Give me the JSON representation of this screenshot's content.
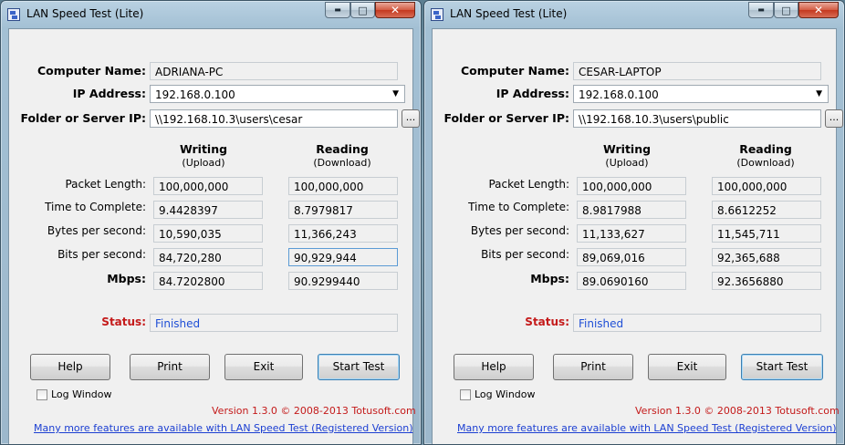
{
  "windows": [
    {
      "title": "LAN Speed Test (Lite)",
      "controls": {
        "minimize": "▬",
        "maximize": "□",
        "close": "✕"
      },
      "labels": {
        "computer_name": "Computer Name:",
        "ip_address": "IP Address:",
        "folder": "Folder or Server IP:",
        "packet_length": "Packet Length:",
        "time_to_complete": "Time to Complete:",
        "bytes_per_second": "Bytes per second:",
        "bits_per_second": "Bits per second:",
        "mbps": "Mbps:",
        "status": "Status:"
      },
      "computer_name": "ADRIANA-PC",
      "ip_address": "192.168.0.100",
      "folder": "\\\\192.168.10.3\\users\\cesar",
      "browse_label": "...",
      "columns": {
        "writing": "Writing",
        "upload": "(Upload)",
        "reading": "Reading",
        "download": "(Download)"
      },
      "rows": {
        "packet_length": {
          "write": "100,000,000",
          "read": "100,000,000"
        },
        "time_to_complete": {
          "write": "9.4428397",
          "read": "8.7979817"
        },
        "bytes_per_second": {
          "write": "10,590,035",
          "read": "11,366,243"
        },
        "bits_per_second": {
          "write": "84,720,280",
          "read": "90,929,944"
        },
        "mbps": {
          "write": "84.7202800",
          "read": "90.9299440"
        }
      },
      "status": "Finished",
      "buttons": {
        "help": "Help",
        "print": "Print",
        "exit": "Exit",
        "start": "Start Test"
      },
      "log_window": "Log Window",
      "version": "Version 1.3.0 © 2008-2013 Totusoft.com",
      "link": "Many more features are available with LAN Speed Test (Registered Version)"
    },
    {
      "title": "LAN Speed Test (Lite)",
      "controls": {
        "minimize": "▬",
        "maximize": "□",
        "close": "✕"
      },
      "labels": {
        "computer_name": "Computer Name:",
        "ip_address": "IP Address:",
        "folder": "Folder or Server IP:",
        "packet_length": "Packet Length:",
        "time_to_complete": "Time to Complete:",
        "bytes_per_second": "Bytes per second:",
        "bits_per_second": "Bits per second:",
        "mbps": "Mbps:",
        "status": "Status:"
      },
      "computer_name": "CESAR-LAPTOP",
      "ip_address": "192.168.0.100",
      "folder": "\\\\192.168.10.3\\users\\public",
      "browse_label": "...",
      "columns": {
        "writing": "Writing",
        "upload": "(Upload)",
        "reading": "Reading",
        "download": "(Download)"
      },
      "rows": {
        "packet_length": {
          "write": "100,000,000",
          "read": "100,000,000"
        },
        "time_to_complete": {
          "write": "8.9817988",
          "read": "8.6612252"
        },
        "bytes_per_second": {
          "write": "11,133,627",
          "read": "11,545,711"
        },
        "bits_per_second": {
          "write": "89,069,016",
          "read": "92,365,688"
        },
        "mbps": {
          "write": "89.0690160",
          "read": "92.3656880"
        }
      },
      "status": "Finished",
      "buttons": {
        "help": "Help",
        "print": "Print",
        "exit": "Exit",
        "start": "Start Test"
      },
      "log_window": "Log Window",
      "version": "Version 1.3.0 © 2008-2013 Totusoft.com",
      "link": "Many more features are available with LAN Speed Test (Registered Version)"
    }
  ]
}
